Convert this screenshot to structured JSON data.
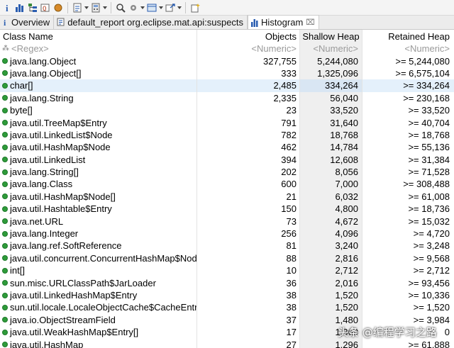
{
  "toolbar": {
    "buttons": [
      "info-icon",
      "histogram-icon",
      "dominator-tree-icon",
      "object-query-icon",
      "object-icon",
      "report-icon",
      "search-icon",
      "calculator-icon",
      "group-icon",
      "export-icon",
      "export-dropdown-icon",
      "new-icon"
    ]
  },
  "tabs": [
    {
      "label": "Overview",
      "icon": "info-icon"
    },
    {
      "label": "default_report  org.eclipse.mat.api:suspects",
      "icon": "report-icon"
    },
    {
      "label": "Histogram",
      "icon": "histogram-icon",
      "active": true,
      "close": "⌧"
    }
  ],
  "columns": {
    "name": "Class Name",
    "objects": "Objects",
    "shallow": "Shallow Heap",
    "retained": "Retained Heap"
  },
  "filter": {
    "name": "<Regex>",
    "objects": "<Numeric>",
    "shallow": "<Numeric>",
    "retained": "<Numeric>"
  },
  "rows": [
    {
      "name": "java.lang.Object",
      "objects": "327,755",
      "shallow": "5,244,080",
      "retained": ">= 5,244,080"
    },
    {
      "name": "java.lang.Object[]",
      "objects": "333",
      "shallow": "1,325,096",
      "retained": ">= 6,575,104"
    },
    {
      "name": "char[]",
      "objects": "2,485",
      "shallow": "334,264",
      "retained": ">= 334,264",
      "selected": true
    },
    {
      "name": "java.lang.String",
      "objects": "2,335",
      "shallow": "56,040",
      "retained": ">= 230,168"
    },
    {
      "name": "byte[]",
      "objects": "23",
      "shallow": "33,520",
      "retained": ">= 33,520"
    },
    {
      "name": "java.util.TreeMap$Entry",
      "objects": "791",
      "shallow": "31,640",
      "retained": ">= 40,704"
    },
    {
      "name": "java.util.LinkedList$Node",
      "objects": "782",
      "shallow": "18,768",
      "retained": ">= 18,768"
    },
    {
      "name": "java.util.HashMap$Node",
      "objects": "462",
      "shallow": "14,784",
      "retained": ">= 55,136"
    },
    {
      "name": "java.util.LinkedList",
      "objects": "394",
      "shallow": "12,608",
      "retained": ">= 31,384"
    },
    {
      "name": "java.lang.String[]",
      "objects": "202",
      "shallow": "8,056",
      "retained": ">= 71,528"
    },
    {
      "name": "java.lang.Class",
      "objects": "600",
      "shallow": "7,000",
      "retained": ">= 308,488"
    },
    {
      "name": "java.util.HashMap$Node[]",
      "objects": "21",
      "shallow": "6,032",
      "retained": ">= 61,008"
    },
    {
      "name": "java.util.Hashtable$Entry",
      "objects": "150",
      "shallow": "4,800",
      "retained": ">= 18,736"
    },
    {
      "name": "java.net.URL",
      "objects": "73",
      "shallow": "4,672",
      "retained": ">= 15,032"
    },
    {
      "name": "java.lang.Integer",
      "objects": "256",
      "shallow": "4,096",
      "retained": ">= 4,720"
    },
    {
      "name": "java.lang.ref.SoftReference",
      "objects": "81",
      "shallow": "3,240",
      "retained": ">= 3,248"
    },
    {
      "name": "java.util.concurrent.ConcurrentHashMap$Node",
      "objects": "88",
      "shallow": "2,816",
      "retained": ">= 9,568"
    },
    {
      "name": "int[]",
      "objects": "10",
      "shallow": "2,712",
      "retained": ">= 2,712"
    },
    {
      "name": "sun.misc.URLClassPath$JarLoader",
      "objects": "36",
      "shallow": "2,016",
      "retained": ">= 93,456"
    },
    {
      "name": "java.util.LinkedHashMap$Entry",
      "objects": "38",
      "shallow": "1,520",
      "retained": ">= 10,336"
    },
    {
      "name": "sun.util.locale.LocaleObjectCache$CacheEntry",
      "objects": "38",
      "shallow": "1,520",
      "retained": ">= 1,520"
    },
    {
      "name": "java.io.ObjectStreamField",
      "objects": "37",
      "shallow": "1,480",
      "retained": ">= 3,984"
    },
    {
      "name": "java.util.WeakHashMap$Entry[]",
      "objects": "17",
      "shallow": "1,360",
      "retained": "0"
    },
    {
      "name": "java.util.HashMap",
      "objects": "27",
      "shallow": "1,296",
      "retained": ">= 61,888"
    }
  ],
  "watermark": "头条 @编程学习之路",
  "colors": {
    "class_icon": "#2e9b3a",
    "selected_row": "#e4f0fb",
    "shallow_column": "#efefef"
  }
}
